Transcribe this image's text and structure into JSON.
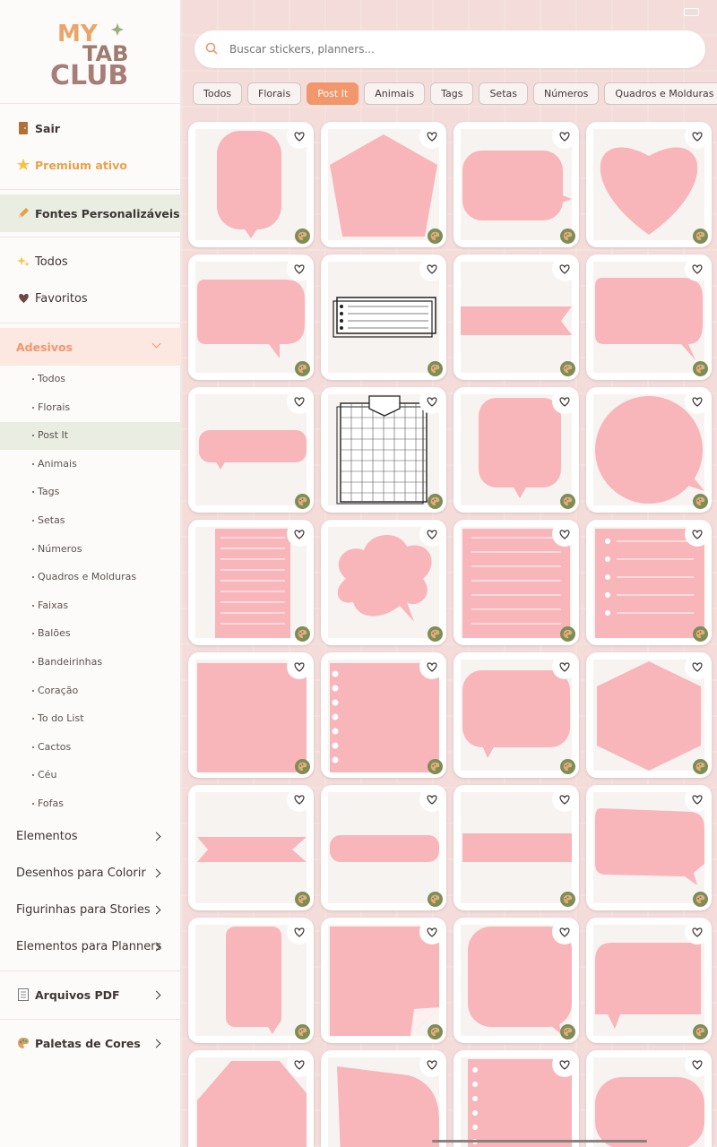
{
  "logo": {
    "line1": "MY",
    "line2": "TAB",
    "line3": "CLUB"
  },
  "sidebar": {
    "logout": "Sair",
    "premium": "Premium ativo",
    "fonts": "Fontes Personalizáveis",
    "all": "Todos",
    "favorites": "Favoritos",
    "stickers_section": "Adesivos",
    "sub_items": [
      "Todos",
      "Florais",
      "Post It",
      "Animais",
      "Tags",
      "Setas",
      "Números",
      "Quadros e Molduras",
      "Faixas",
      "Balões",
      "Bandeirinhas",
      "Coração",
      "To do List",
      "Cactos",
      "Céu",
      "Fofas"
    ],
    "sections": [
      "Elementos",
      "Desenhos para Colorir",
      "Figurinhas para Stories",
      "Elementos para Planners"
    ],
    "pdf": "Arquivos PDF",
    "palettes": "Paletas de Cores"
  },
  "search": {
    "placeholder": "Buscar stickers, planners..."
  },
  "filters": [
    "Todos",
    "Florais",
    "Post It",
    "Animais",
    "Tags",
    "Setas",
    "Números",
    "Quadros e Molduras"
  ],
  "active_filter": "Post It",
  "sticker_grid": {
    "rows": 8,
    "cols": 4,
    "icons": [
      "heart-outline-icon",
      "palette-icon"
    ]
  },
  "colors": {
    "accent": "#f2966b",
    "sticker_pink": "#f8b5ba",
    "selected_bg": "#e9ede2",
    "section_bg": "#fce8e0",
    "premium": "#e8a24a",
    "palette_badge": "#7e8d57"
  }
}
